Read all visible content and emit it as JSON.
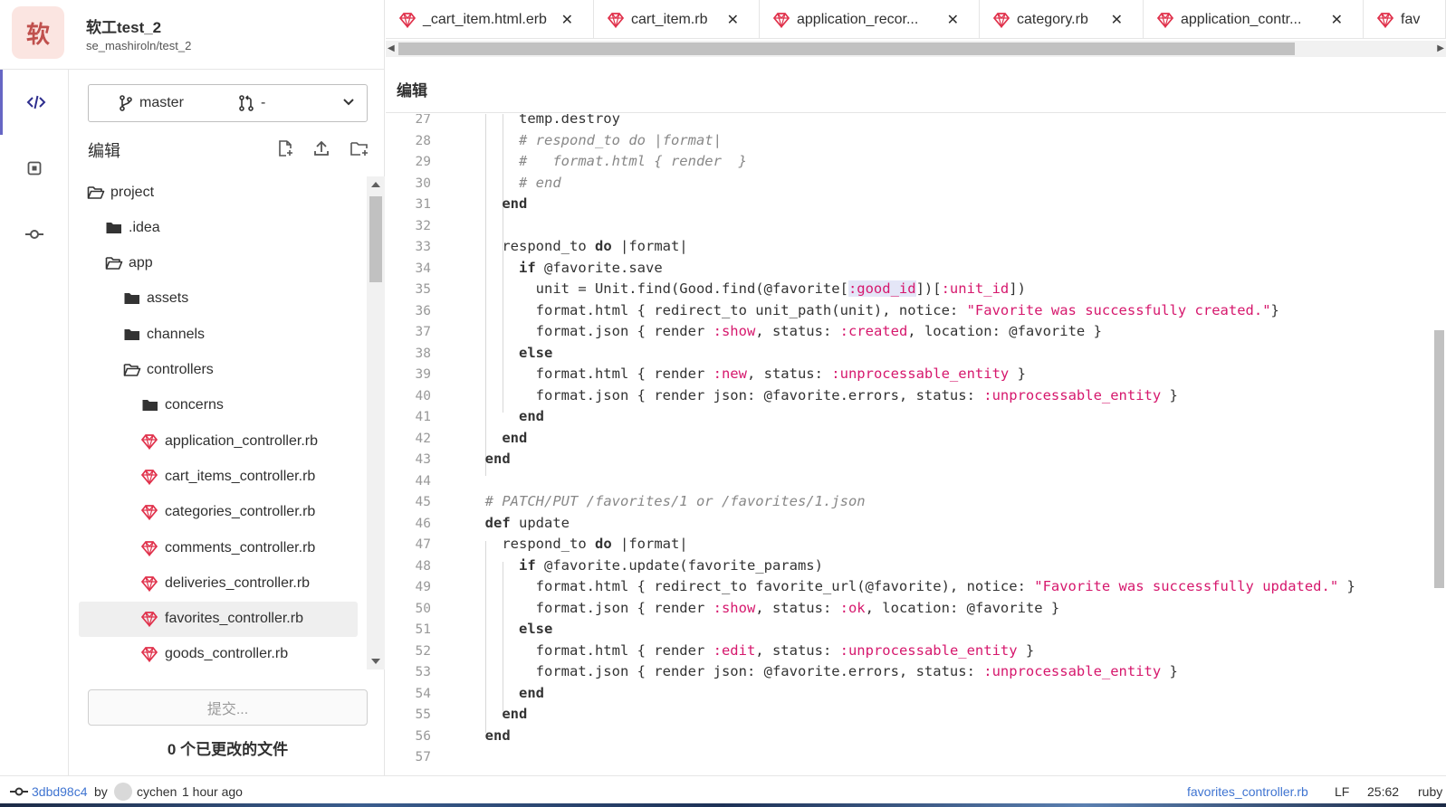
{
  "project": {
    "avatar_letter": "软",
    "name": "软工test_2",
    "path": "se_mashiroln/test_2"
  },
  "branch": {
    "name": "master",
    "merge_request": "-"
  },
  "sidebar": {
    "edit_label": "编辑"
  },
  "tree": [
    {
      "label": "project",
      "type": "folder-open",
      "depth": 0
    },
    {
      "label": ".idea",
      "type": "folder",
      "depth": 1
    },
    {
      "label": "app",
      "type": "folder-open",
      "depth": 1
    },
    {
      "label": "assets",
      "type": "folder",
      "depth": 2
    },
    {
      "label": "channels",
      "type": "folder",
      "depth": 2
    },
    {
      "label": "controllers",
      "type": "folder-open",
      "depth": 2
    },
    {
      "label": "concerns",
      "type": "folder",
      "depth": 3
    },
    {
      "label": "application_controller.rb",
      "type": "ruby",
      "depth": 3
    },
    {
      "label": "cart_items_controller.rb",
      "type": "ruby",
      "depth": 3
    },
    {
      "label": "categories_controller.rb",
      "type": "ruby",
      "depth": 3
    },
    {
      "label": "comments_controller.rb",
      "type": "ruby",
      "depth": 3
    },
    {
      "label": "deliveries_controller.rb",
      "type": "ruby",
      "depth": 3
    },
    {
      "label": "favorites_controller.rb",
      "type": "ruby",
      "depth": 3,
      "selected": true
    },
    {
      "label": "goods_controller.rb",
      "type": "ruby",
      "depth": 3
    }
  ],
  "commit": {
    "button_label": "提交...",
    "changed_files": "0 个已更改的文件"
  },
  "tabs": [
    {
      "label": "_cart_item.html.erb"
    },
    {
      "label": "cart_item.rb"
    },
    {
      "label": "application_recor..."
    },
    {
      "label": "category.rb"
    },
    {
      "label": "application_contr..."
    },
    {
      "label": "fav"
    }
  ],
  "editor": {
    "mode_label": "编辑"
  },
  "code_lines": [
    {
      "n": "27",
      "html": "      temp.destroy"
    },
    {
      "n": "28",
      "html": "      <span class=\"cmt\"># respond_to do |format|</span>"
    },
    {
      "n": "29",
      "html": "      <span class=\"cmt\">#   format.html { render  }</span>"
    },
    {
      "n": "30",
      "html": "      <span class=\"cmt\"># end</span>"
    },
    {
      "n": "31",
      "html": "    <span class=\"kw\">end</span>"
    },
    {
      "n": "32",
      "html": ""
    },
    {
      "n": "33",
      "html": "    respond_to <span class=\"kw\">do</span> |format|"
    },
    {
      "n": "34",
      "html": "      <span class=\"kw\">if</span> @favorite.save"
    },
    {
      "n": "35",
      "html": "        unit = Unit.find(Good.find(@favorite[<span class=\"sym hl\">:good_id</span>])[<span class=\"sym\">:unit_id</span>])"
    },
    {
      "n": "36",
      "html": "        format.html { redirect_to unit_path(unit), notice: <span class=\"str\">\"Favorite was successfully created.\"</span>}"
    },
    {
      "n": "37",
      "html": "        format.json { render <span class=\"sym\">:show</span>, status: <span class=\"sym\">:created</span>, location: @favorite }"
    },
    {
      "n": "38",
      "html": "      <span class=\"kw\">else</span>"
    },
    {
      "n": "39",
      "html": "        format.html { render <span class=\"sym\">:new</span>, status: <span class=\"sym\">:unprocessable_entity</span> }"
    },
    {
      "n": "40",
      "html": "        format.json { render json: @favorite.errors, status: <span class=\"sym\">:unprocessable_entity</span> }"
    },
    {
      "n": "41",
      "html": "      <span class=\"kw\">end</span>"
    },
    {
      "n": "42",
      "html": "    <span class=\"kw\">end</span>"
    },
    {
      "n": "43",
      "html": "  <span class=\"kw\">end</span>"
    },
    {
      "n": "44",
      "html": ""
    },
    {
      "n": "45",
      "html": "  <span class=\"cmt\"># PATCH/PUT /favorites/1 or /favorites/1.json</span>"
    },
    {
      "n": "46",
      "html": "  <span class=\"kw\">def</span> update"
    },
    {
      "n": "47",
      "html": "    respond_to <span class=\"kw\">do</span> |format|"
    },
    {
      "n": "48",
      "html": "      <span class=\"kw\">if</span> @favorite.update(favorite_params)"
    },
    {
      "n": "49",
      "html": "        format.html { redirect_to favorite_url(@favorite), notice: <span class=\"str\">\"Favorite was successfully updated.\"</span> }"
    },
    {
      "n": "50",
      "html": "        format.json { render <span class=\"sym\">:show</span>, status: <span class=\"sym\">:ok</span>, location: @favorite }"
    },
    {
      "n": "51",
      "html": "      <span class=\"kw\">else</span>"
    },
    {
      "n": "52",
      "html": "        format.html { render <span class=\"sym\">:edit</span>, status: <span class=\"sym\">:unprocessable_entity</span> }"
    },
    {
      "n": "53",
      "html": "        format.json { render json: @favorite.errors, status: <span class=\"sym\">:unprocessable_entity</span> }"
    },
    {
      "n": "54",
      "html": "      <span class=\"kw\">end</span>"
    },
    {
      "n": "55",
      "html": "    <span class=\"kw\">end</span>"
    },
    {
      "n": "56",
      "html": "  <span class=\"kw\">end</span>"
    },
    {
      "n": "57",
      "html": ""
    }
  ],
  "status": {
    "commit_hash": "3dbd98c4",
    "by": "by",
    "author": "cychen",
    "time": "1 hour ago",
    "file": "favorites_controller.rb",
    "eol": "LF",
    "position": "25:62",
    "language": "ruby"
  },
  "colors": {
    "accent": "#6666c4",
    "ruby": "#e0314b",
    "symbol": "#d6186d",
    "link": "#3f74d1"
  }
}
